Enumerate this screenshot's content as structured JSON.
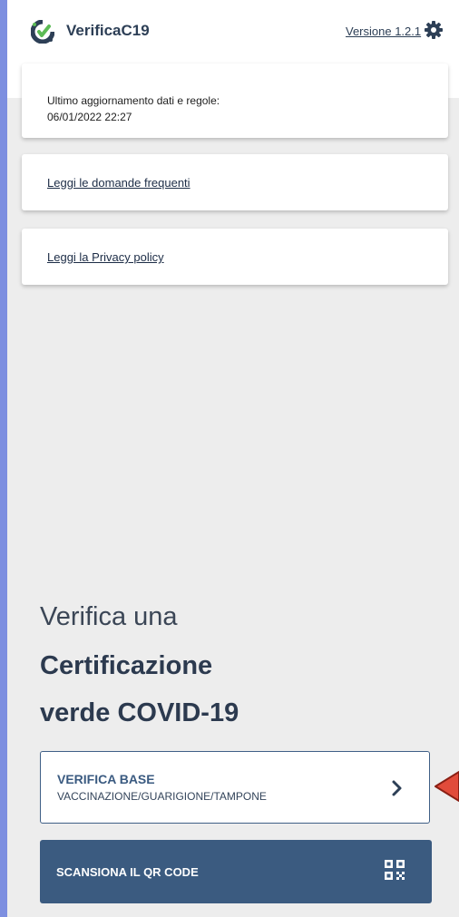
{
  "app": {
    "title": "VerificaC19",
    "version_label": "Versione 1.2.1"
  },
  "update_card": {
    "label": "Ultimo aggiornamento dati e regole:",
    "date": "06/01/2022 22:27"
  },
  "links": {
    "faq": "Leggi le domande frequenti",
    "privacy": "Leggi la Privacy policy"
  },
  "hero": {
    "line1": "Verifica una",
    "line2": "Certificazione",
    "line3": "verde COVID-19"
  },
  "verify_base": {
    "title": "VERIFICA BASE",
    "subtitle": "VACCINAZIONE/GUARIGIONE/TAMPONE"
  },
  "scan": {
    "label": "SCANSIONA IL QR CODE"
  },
  "icons": {
    "logo": "verificac19-logo-icon",
    "settings": "gear-icon",
    "chevron": "chevron-right-icon",
    "qr": "qr-code-icon"
  },
  "colors": {
    "primary": "#3b5b80",
    "background": "#ededed",
    "page_frame": "#7d8fe0",
    "marker": "#e14b3a"
  }
}
